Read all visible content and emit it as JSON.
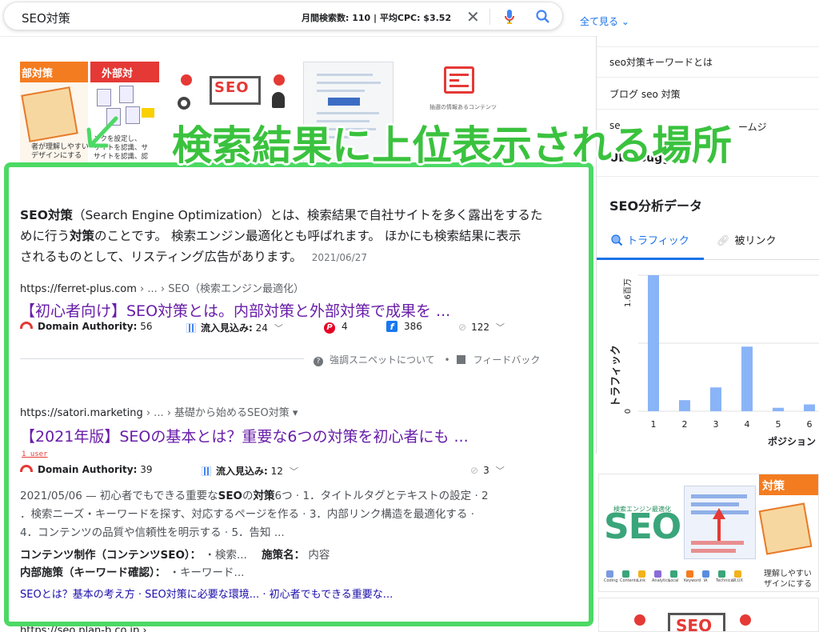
{
  "search": {
    "query": "SEO対策",
    "stats": "月間検索数: 110 | 平均CPC: $3.52",
    "clear_icon": "close-icon",
    "mic_icon": "mic-icon",
    "search_icon": "search-icon"
  },
  "show_all": "全て見る ⌄",
  "thumbs": {
    "t1_band": "部対策",
    "t1_text": "者が理解しやすい\nデザインにする",
    "t2_band": "外部対",
    "t2_text": "ンクを設定し、\nサイトを認識、サ\nサイトを認識、認",
    "t3_label": "SEO",
    "t5_caption": "抽選の情報あるコンテンツ"
  },
  "overlay_title": "検索結果に上位表示される場所",
  "featured": {
    "snippet_html_parts": {
      "bold1": "SEO対策",
      "text1": "（Search Engine Optimization）とは、検索結果で自社サイトを多く露出をするた",
      "text2": "めに行う",
      "bold2": "対策",
      "text3": "のことです。 検索エンジン最適化とも呼ばれます。 ほかにも検索結果に表示",
      "text4": "されるものとして、リスティング広告があります。",
      "date": "2021/06/27"
    },
    "url": "https://ferret-plus.com",
    "url_rest": " › ... › SEO（検索エンジン最適化）",
    "title": "【初心者向け】SEO対策とは。内部対策と外部対策で成果を ...",
    "metrics": {
      "da_label": "Domain Authority:",
      "da_value": "56",
      "inflow_label": "流入見込み:",
      "inflow_value": "24",
      "pinterest": "4",
      "facebook": "386",
      "links": "122"
    },
    "feedback_about": "強調スニペットについて",
    "feedback_dot": "•",
    "feedback": "フィードバック"
  },
  "result2": {
    "url": "https://satori.marketing",
    "url_rest": " › ... › 基礎から始めるSEO対策 ▾",
    "title": "【2021年版】SEOの基本とは？重要な6つの対策を初心者にも ...",
    "user_badge": "1 user",
    "metrics": {
      "da_label": "Domain Authority:",
      "da_value": "39",
      "inflow_label": "流入見込み:",
      "inflow_value": "12",
      "links": "3"
    },
    "desc_line1_a": "2021/05/06 — 初心者でもできる重要な",
    "desc_line1_b": "SEO",
    "desc_line1_c": "の",
    "desc_line1_d": "対策",
    "desc_line1_e": "6つ · 1．タイトルタグとテキストの設定 · 2",
    "desc_line2": "．検索ニーズ・キーワードを探す、対応するページを作る · 3．内部リンク構造を最適化する ·",
    "desc_line3": "4．コンテンツの品質や信頼性を明示する · 5．告知 ...",
    "kv1_key": "コンテンツ制作（コンテンツSEO）：",
    "kv1_val": " ・検索...",
    "kv2_key": "施策名：",
    "kv2_val": " 内容",
    "kv3_key": "内部施策（キーワード確認）：",
    "kv3_val": " ・キーワード...",
    "sitelinks": "SEOとは？基本の考え方 · SEO対策に必要な環境... · 初心者でもできる重要な..."
  },
  "cutoff_url": "https://seo.plan-b.co.jp › ...",
  "right_panel": {
    "related": [
      "seo対策キーワードとは",
      "ブログ seo 対策",
      "se"
    ],
    "related3_tail": "ームジ",
    "ubersuggest": "Ubersuggest",
    "seo_data_title": "SEO分析データ",
    "tab_traffic": "トラフィック",
    "tab_links": "被リンク"
  },
  "chart_data": {
    "type": "bar",
    "categories": [
      "1",
      "2",
      "3",
      "4",
      "5",
      "6"
    ],
    "values": [
      1.6,
      0.13,
      0.28,
      0.76,
      0.04,
      0.08
    ],
    "ylabel": "トラフィック",
    "xlabel": "ポジション",
    "y_top_label": "1.6百万",
    "y_zero_label": "0",
    "bar_color": "#8ab4f8",
    "ylim": [
      0,
      1.6
    ]
  },
  "right_images": {
    "seo": "SEO",
    "engine": "検索エンジン最適化",
    "band": "対策",
    "text": "理解しやすい\nザインにする",
    "icons": [
      "Coding",
      "Contents",
      "Link",
      "Analytics",
      "Local",
      "Keyword",
      "IA",
      "Technical",
      "UI,UX"
    ],
    "bottom_seo": "SEO"
  },
  "colors": {
    "green_highlight": "#4cd964",
    "overlay_text": "#3ac23e",
    "visited_link": "#681da8",
    "link": "#1a0dab",
    "accent_blue": "#1a73e8"
  }
}
